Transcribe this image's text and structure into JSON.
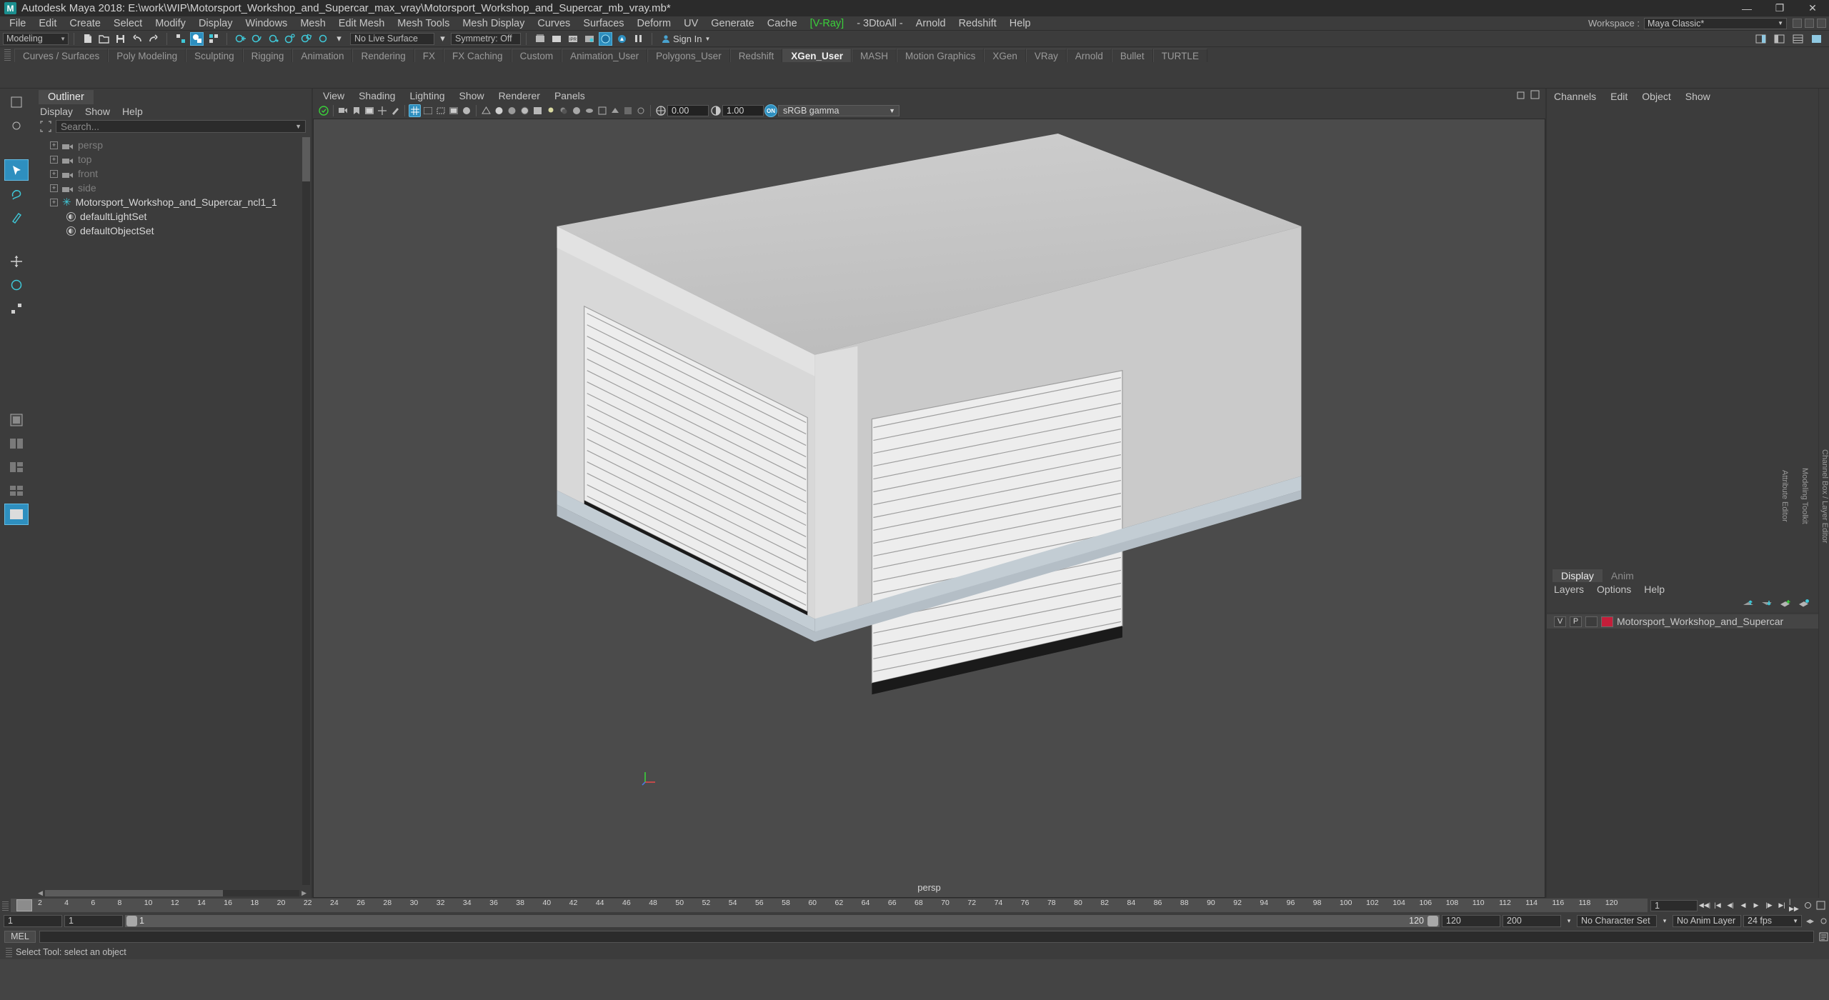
{
  "window": {
    "title": "Autodesk Maya 2018: E:\\work\\WIP\\Motorsport_Workshop_and_Supercar_max_vray\\Motorsport_Workshop_and_Supercar_mb_vray.mb*",
    "logo": "M",
    "minimize": "—",
    "maximize": "❐",
    "close": "✕"
  },
  "menubar": {
    "items": [
      {
        "label": "File"
      },
      {
        "label": "Edit"
      },
      {
        "label": "Create"
      },
      {
        "label": "Select"
      },
      {
        "label": "Modify"
      },
      {
        "label": "Display"
      },
      {
        "label": "Windows"
      },
      {
        "label": "Mesh"
      },
      {
        "label": "Edit Mesh"
      },
      {
        "label": "Mesh Tools"
      },
      {
        "label": "Mesh Display"
      },
      {
        "label": "Curves"
      },
      {
        "label": "Surfaces"
      },
      {
        "label": "Deform"
      },
      {
        "label": "UV"
      },
      {
        "label": "Generate"
      },
      {
        "label": "Cache"
      },
      {
        "label": "[V-Ray]",
        "accent": "#3ad13a"
      },
      {
        "label": "- 3DtoAll -"
      },
      {
        "label": "Arnold"
      },
      {
        "label": "Redshift"
      },
      {
        "label": "Help"
      }
    ],
    "workspace_label": "Workspace :",
    "workspace_value": "Maya Classic*"
  },
  "statusline": {
    "mode": "Modeling",
    "live_surface": "No Live Surface",
    "symmetry": "Symmetry: Off",
    "signin": "Sign In"
  },
  "shelf": {
    "tabs": [
      {
        "label": "Curves / Surfaces",
        "active": false
      },
      {
        "label": "Poly Modeling",
        "active": false
      },
      {
        "label": "Sculpting",
        "active": false
      },
      {
        "label": "Rigging",
        "active": false
      },
      {
        "label": "Animation",
        "active": false
      },
      {
        "label": "Rendering",
        "active": false
      },
      {
        "label": "FX",
        "active": false
      },
      {
        "label": "FX Caching",
        "active": false
      },
      {
        "label": "Custom",
        "active": false
      },
      {
        "label": "Animation_User",
        "active": false
      },
      {
        "label": "Polygons_User",
        "active": false
      },
      {
        "label": "Redshift",
        "active": false
      },
      {
        "label": "XGen_User",
        "active": true
      },
      {
        "label": "MASH",
        "active": false
      },
      {
        "label": "Motion Graphics",
        "active": false
      },
      {
        "label": "XGen",
        "active": false
      },
      {
        "label": "VRay",
        "active": false
      },
      {
        "label": "Arnold",
        "active": false
      },
      {
        "label": "Bullet",
        "active": false
      },
      {
        "label": "TURTLE",
        "active": false
      }
    ]
  },
  "outliner": {
    "tab": "Outliner",
    "menus": [
      "Display",
      "Show",
      "Help"
    ],
    "search_placeholder": "Search...",
    "items": [
      {
        "label": "persp",
        "icon": "camera-icon",
        "expandable": true,
        "dim": true
      },
      {
        "label": "top",
        "icon": "camera-icon",
        "expandable": true,
        "dim": true
      },
      {
        "label": "front",
        "icon": "camera-icon",
        "expandable": true,
        "dim": true
      },
      {
        "label": "side",
        "icon": "camera-icon",
        "expandable": true,
        "dim": true
      },
      {
        "label": "Motorsport_Workshop_and_Supercar_ncl1_1",
        "icon": "group-star-icon",
        "expandable": true,
        "dim": false
      },
      {
        "label": "defaultLightSet",
        "icon": "set-icon",
        "expandable": false,
        "dim": false
      },
      {
        "label": "defaultObjectSet",
        "icon": "set-icon",
        "expandable": false,
        "dim": false
      }
    ]
  },
  "viewport": {
    "menus": [
      "View",
      "Shading",
      "Lighting",
      "Show",
      "Renderer",
      "Panels"
    ],
    "exposure": "0.00",
    "gamma": "1.00",
    "color_mgmt": "sRGB gamma",
    "camera_label": "persp"
  },
  "channelbox": {
    "menus": [
      "Channels",
      "Edit",
      "Object",
      "Show"
    ],
    "side_tabs": [
      "Channel Box / Layer Editor",
      "Modeling Toolkit",
      "Attribute Editor"
    ]
  },
  "layers": {
    "tabs": [
      {
        "label": "Display",
        "active": true
      },
      {
        "label": "Anim",
        "active": false
      }
    ],
    "menus": [
      "Layers",
      "Options",
      "Help"
    ],
    "rows": [
      {
        "v": "V",
        "p": "P",
        "color": "#c41e3a",
        "name": "Motorsport_Workshop_and_Supercar"
      }
    ]
  },
  "timeslider": {
    "ticks": [
      "2",
      "4",
      "6",
      "8",
      "10",
      "12",
      "14",
      "16",
      "18",
      "20",
      "22",
      "24",
      "26",
      "28",
      "30",
      "32",
      "34",
      "36",
      "38",
      "40",
      "42",
      "44",
      "46",
      "48",
      "50",
      "52",
      "54",
      "56",
      "58",
      "60",
      "62",
      "64",
      "66",
      "68",
      "70",
      "72",
      "74",
      "76",
      "78",
      "80",
      "82",
      "84",
      "86",
      "88",
      "90",
      "92",
      "94",
      "96",
      "98",
      "100",
      "102",
      "104",
      "106",
      "108",
      "110",
      "112",
      "114",
      "116",
      "118",
      "120"
    ],
    "current_frame": "1",
    "fps": "24 fps",
    "start": "1",
    "end": "1",
    "range_start": "120",
    "range_start2": "120",
    "range_end": "200",
    "playhead_label": "1",
    "range_label_left": "1",
    "range_label_right": "120",
    "character_set": "No Character Set",
    "anim_layer": "No Anim Layer"
  },
  "command": {
    "language": "MEL",
    "input_value": ""
  },
  "status": {
    "message": "Select Tool: select an object"
  }
}
